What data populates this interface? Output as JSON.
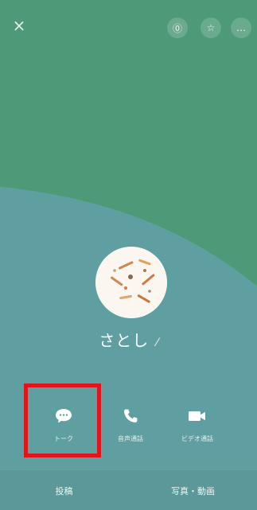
{
  "colors": {
    "top_green": "#4e9a78",
    "bottom_teal": "#5f9fa2",
    "highlight": "#e0151b"
  },
  "topbar": {
    "close_glyph": "×",
    "share_glyph": "⓪",
    "star_glyph": "☆",
    "more_glyph": "…"
  },
  "profile": {
    "name": "さとし",
    "edit_glyph": "⁄"
  },
  "actions": [
    {
      "label": "トーク",
      "icon": "chat-bubble-icon"
    },
    {
      "label": "音声通話",
      "icon": "phone-icon"
    },
    {
      "label": "ビデオ通話",
      "icon": "video-camera-icon"
    }
  ],
  "bottom_bar": {
    "left_label": "投稿",
    "right_label": "写真・動画"
  }
}
